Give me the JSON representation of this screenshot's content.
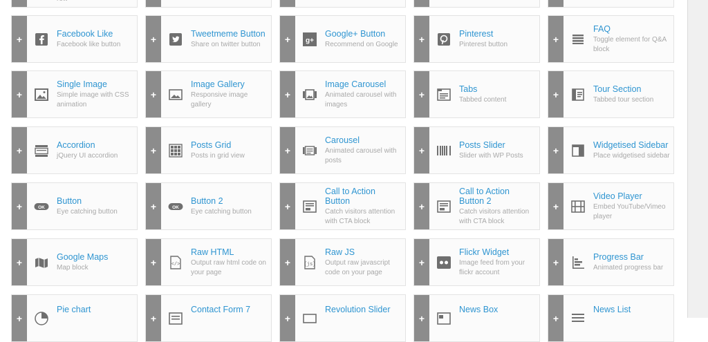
{
  "top_partial": {
    "desc": "row"
  },
  "rows": [
    [
      {
        "title": "Facebook Like",
        "desc": "Facebook like button",
        "icon": "facebook-icon"
      },
      {
        "title": "Tweetmeme Button",
        "desc": "Share on twitter button",
        "icon": "twitter-icon"
      },
      {
        "title": "Google+ Button",
        "desc": "Recommend on Google",
        "icon": "google-plus-icon"
      },
      {
        "title": "Pinterest",
        "desc": "Pinterest button",
        "icon": "pinterest-icon"
      },
      {
        "title": "FAQ",
        "desc": "Toggle element for Q&A block",
        "icon": "faq-icon"
      }
    ],
    [
      {
        "title": "Single Image",
        "desc": "Simple image with CSS animation",
        "icon": "image-icon"
      },
      {
        "title": "Image Gallery",
        "desc": "Responsive image gallery",
        "icon": "gallery-icon"
      },
      {
        "title": "Image Carousel",
        "desc": "Animated carousel with images",
        "icon": "image-carousel-icon"
      },
      {
        "title": "Tabs",
        "desc": "Tabbed content",
        "icon": "tabs-icon"
      },
      {
        "title": "Tour Section",
        "desc": "Tabbed tour section",
        "icon": "tour-icon"
      }
    ],
    [
      {
        "title": "Accordion",
        "desc": "jQuery UI accordion",
        "icon": "accordion-icon"
      },
      {
        "title": "Posts Grid",
        "desc": "Posts in grid view",
        "icon": "posts-grid-icon"
      },
      {
        "title": "Carousel",
        "desc": "Animated carousel with posts",
        "icon": "carousel-icon"
      },
      {
        "title": "Posts Slider",
        "desc": "Slider with WP Posts",
        "icon": "posts-slider-icon"
      },
      {
        "title": "Widgetised Sidebar",
        "desc": "Place widgetised sidebar",
        "icon": "sidebar-icon"
      }
    ],
    [
      {
        "title": "Button",
        "desc": "Eye catching button",
        "icon": "ok-button-icon",
        "badge": "OK"
      },
      {
        "title": "Button 2",
        "desc": "Eye catching button",
        "icon": "ok-button-icon",
        "badge": "OK"
      },
      {
        "title": "Call to Action Button",
        "desc": "Catch visitors attention with CTA block",
        "icon": "cta-icon"
      },
      {
        "title": "Call to Action Button 2",
        "desc": "Catch visitors attention with CTA block",
        "icon": "cta-icon"
      },
      {
        "title": "Video Player",
        "desc": "Embed YouTube/Vimeo player",
        "icon": "video-icon"
      }
    ],
    [
      {
        "title": "Google Maps",
        "desc": "Map block",
        "icon": "map-icon"
      },
      {
        "title": "Raw HTML",
        "desc": "Output raw html code on your page",
        "icon": "raw-html-icon"
      },
      {
        "title": "Raw JS",
        "desc": "Output raw javascript code on your page",
        "icon": "raw-js-icon"
      },
      {
        "title": "Flickr Widget",
        "desc": "Image feed from your flickr account",
        "icon": "flickr-icon"
      },
      {
        "title": "Progress Bar",
        "desc": "Animated progress bar",
        "icon": "progress-bar-icon"
      }
    ],
    [
      {
        "title": "Pie chart",
        "desc": "",
        "icon": "pie-chart-icon"
      },
      {
        "title": "Contact Form 7",
        "desc": "",
        "icon": "contact-form-icon"
      },
      {
        "title": "Revolution Slider",
        "desc": "",
        "icon": "revolution-slider-icon"
      },
      {
        "title": "News Box",
        "desc": "",
        "icon": "news-box-icon"
      },
      {
        "title": "News List",
        "desc": "",
        "icon": "news-list-icon"
      }
    ]
  ],
  "plus_label": "+",
  "colors": {
    "title": "#2f95d1",
    "desc": "#a9a9a9",
    "plus_bar": "#8c8c8c",
    "icon": "#6f6f6f"
  }
}
